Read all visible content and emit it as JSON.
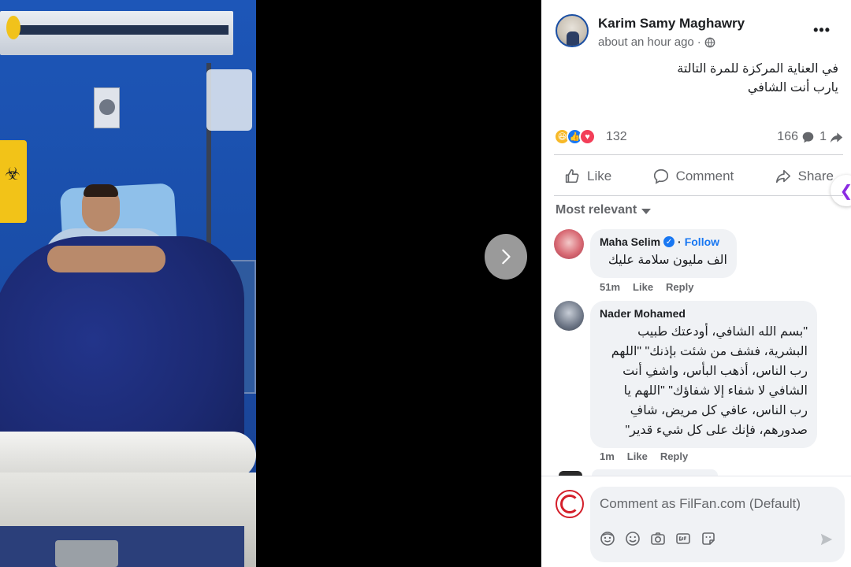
{
  "post": {
    "author": "Karim Samy Maghawry",
    "timestamp": "about an hour ago",
    "audience_separator": "·",
    "audience_icon": "globe-icon",
    "more_label": "•••",
    "text_line1": "في العناية المركزة للمرة التالتة",
    "text_line2": "يارب أنت الشافي"
  },
  "stats": {
    "reaction_types": [
      "haha",
      "like",
      "love"
    ],
    "reaction_count": "132",
    "comment_count": "166",
    "share_count": "1"
  },
  "actions": {
    "like": "Like",
    "comment": "Comment",
    "share": "Share"
  },
  "sort_label": "Most relevant",
  "comments": [
    {
      "name": "Maha Selim",
      "verified": true,
      "follow_label": "Follow",
      "follow_separator": "·",
      "text": "الف مليون سلامة عليك",
      "time": "51m",
      "like_label": "Like",
      "reply_label": "Reply"
    },
    {
      "name": "Nader Mohamed",
      "text_lines": [
        "\"بسم الله الشافي، أودعتك طبيب",
        "البشرية، فشف من شئت بإذنك\" \"اللهم",
        "رب الناس، أذهب البأس، واشفِ أنت",
        "الشافي لا شفاء إلا شفاؤك\" \"اللهم يا",
        "رب الناس، عافي كل مريض، شافِ",
        "صدورهم، فإنك على كل شيء قدير\""
      ],
      "time": "1m",
      "like_label": "Like",
      "reply_label": "Reply"
    }
  ],
  "composer": {
    "placeholder": "Comment as FilFan.com (Default)",
    "tools": [
      "avatar-sticker-icon",
      "emoji-icon",
      "camera-icon",
      "gif-icon",
      "sticker-icon"
    ],
    "send_icon": "send-icon"
  },
  "colors": {
    "brand_blue": "#1877f2",
    "text_primary": "#1c1e21",
    "text_secondary": "#65676b",
    "bubble_bg": "#f0f2f5"
  }
}
